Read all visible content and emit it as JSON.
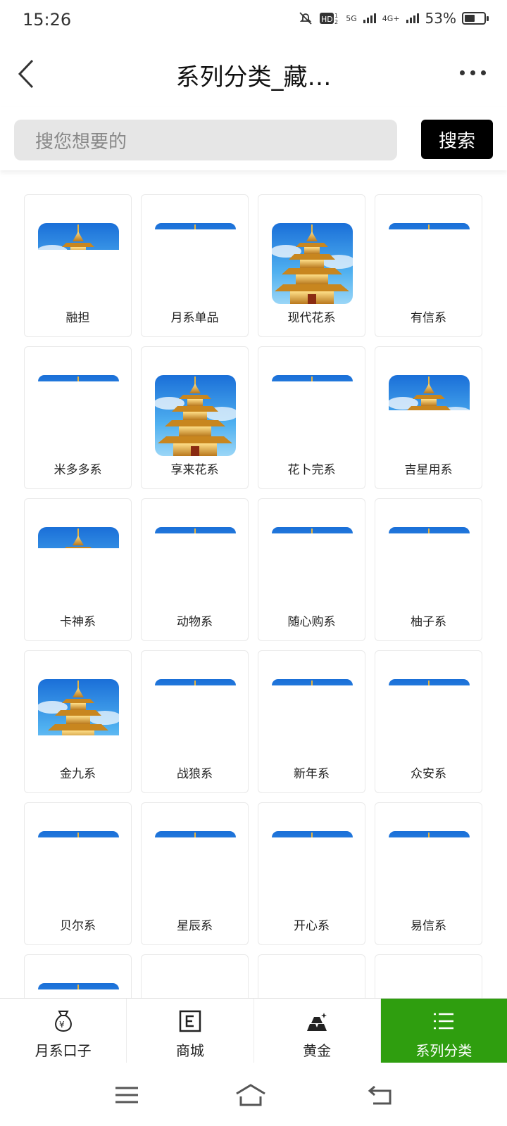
{
  "status_bar": {
    "time": "15:26",
    "battery": "53%",
    "network1": "5G",
    "network2": "4G+"
  },
  "header": {
    "title": "系列分类_藏…"
  },
  "search": {
    "placeholder": "搜您想要的",
    "button_label": "搜索"
  },
  "colors": {
    "accent": "#2f9e0f",
    "sky": "#2a8fe0",
    "gold": "#d9a12b"
  },
  "grid_items": [
    {
      "label": "融担",
      "thumb": "partial"
    },
    {
      "label": "月系单品",
      "thumb": "sliver"
    },
    {
      "label": "现代花系",
      "thumb": "full"
    },
    {
      "label": "有信系",
      "thumb": "sliver"
    },
    {
      "label": "米多多系",
      "thumb": "sliver"
    },
    {
      "label": "享来花系",
      "thumb": "full"
    },
    {
      "label": "花卜完系",
      "thumb": "sliver"
    },
    {
      "label": "吉星用系",
      "thumb": "partial"
    },
    {
      "label": "卡神系",
      "thumb": "partial"
    },
    {
      "label": "动物系",
      "thumb": "sliver"
    },
    {
      "label": "随心购系",
      "thumb": "sliver"
    },
    {
      "label": "柚子系",
      "thumb": "sliver"
    },
    {
      "label": "金九系",
      "thumb": "partial"
    },
    {
      "label": "战狼系",
      "thumb": "sliver"
    },
    {
      "label": "新年系",
      "thumb": "sliver"
    },
    {
      "label": "众安系",
      "thumb": "sliver"
    },
    {
      "label": "贝尔系",
      "thumb": "sliver"
    },
    {
      "label": "星辰系",
      "thumb": "sliver"
    },
    {
      "label": "开心系",
      "thumb": "sliver"
    },
    {
      "label": "易信系",
      "thumb": "sliver"
    },
    {
      "label": "",
      "thumb": "sliver"
    },
    {
      "label": "",
      "thumb": "none"
    },
    {
      "label": "",
      "thumb": "none"
    },
    {
      "label": "",
      "thumb": "none"
    }
  ],
  "tabbar": {
    "tabs": [
      {
        "label": "月系口子",
        "icon": "money-bag-icon"
      },
      {
        "label": "商城",
        "icon": "shop-e-icon"
      },
      {
        "label": "黄金",
        "icon": "gold-bars-icon"
      },
      {
        "label": "系列分类",
        "icon": "list-icon",
        "active": true
      }
    ]
  }
}
